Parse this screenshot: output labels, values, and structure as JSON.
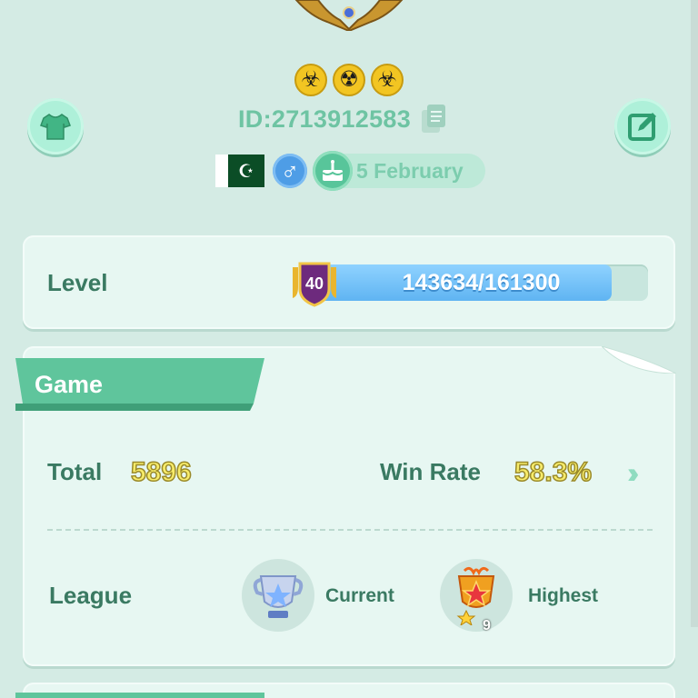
{
  "profile": {
    "id_text": "ID:2713912583",
    "country": "Pakistan",
    "gender_symbol": "♂",
    "birthday": "5 February",
    "badges": [
      {
        "icon": "biohazard-icon",
        "glyph": "☣"
      },
      {
        "icon": "radioactive-icon",
        "glyph": "☢"
      },
      {
        "icon": "biohazard-icon",
        "glyph": "☣"
      }
    ]
  },
  "level": {
    "label": "Level",
    "level_number": "40",
    "xp_text": "143634/161300",
    "xp_current": 143634,
    "xp_max": 161300
  },
  "game": {
    "title": "Game",
    "total_label": "Total",
    "total_value": "5896",
    "winrate_label": "Win Rate",
    "winrate_value": "58.3%",
    "league_label": "League",
    "current_label": "Current",
    "highest_label": "Highest",
    "highest_stars": "9"
  },
  "colors": {
    "background": "#d4ebe4",
    "accent_green": "#3a7a62",
    "value_yellow": "#f7ec6a",
    "xp_blue": "#5fb4f2"
  }
}
